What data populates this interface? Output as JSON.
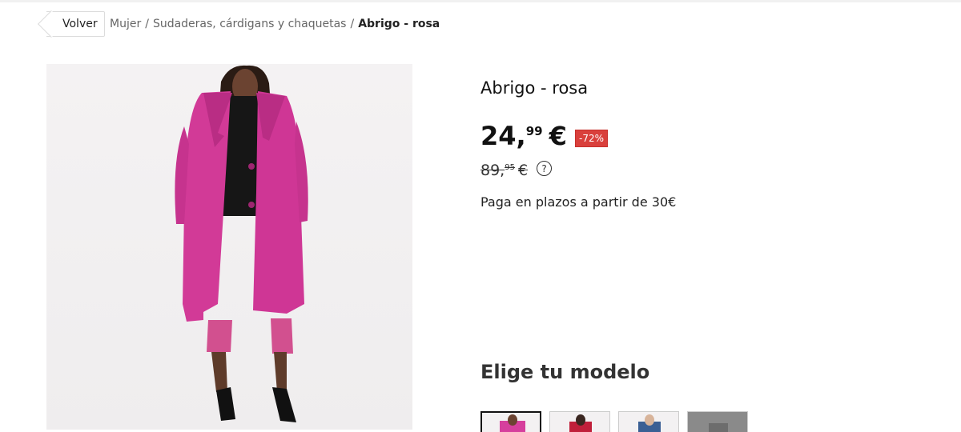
{
  "breadcrumb": {
    "back_label": "Volver",
    "items": [
      "Mujer",
      "Sudaderas, cárdigans y chaquetas"
    ],
    "separator": "/",
    "current": "Abrigo - rosa"
  },
  "product": {
    "title": "Abrigo - rosa",
    "price_int": "24,",
    "price_dec": "99",
    "currency": "€",
    "discount": "-72%",
    "old_price_int": "89,",
    "old_price_dec": "95",
    "help_symbol": "?",
    "installments": "Paga en plazos a partir de 30€",
    "image_alt": "pink-coat-photo"
  },
  "models": {
    "title": "Elige tu modelo",
    "thumbnails": [
      {
        "color": "#d63f9d",
        "selected": true
      },
      {
        "color": "#c01f3a",
        "selected": false
      },
      {
        "color": "#3a5f94",
        "selected": false
      },
      {
        "color": "#7a7a7a",
        "selected": false
      }
    ]
  },
  "colors": {
    "coat": "#d23a97",
    "discount": "#d9403c"
  }
}
